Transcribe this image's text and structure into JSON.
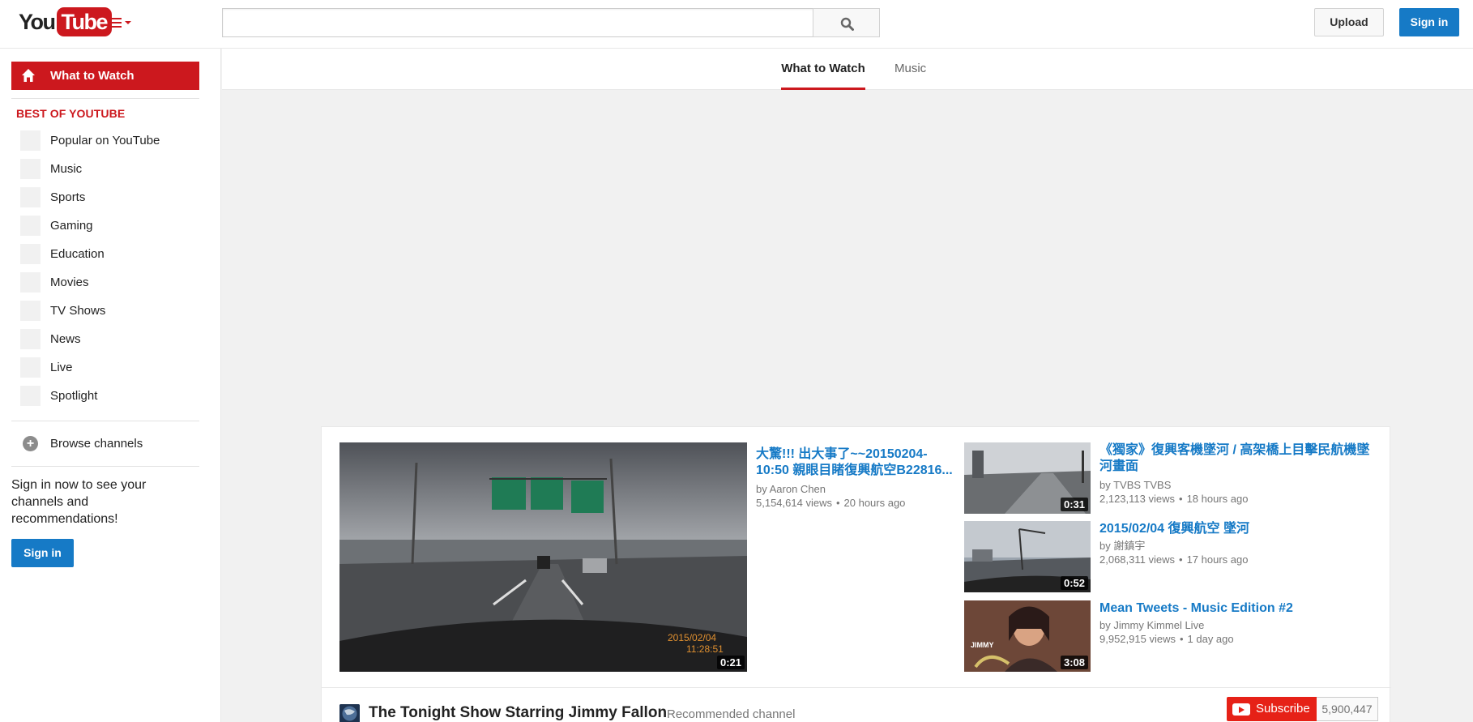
{
  "header": {
    "logo_you": "You",
    "logo_tube": "Tube",
    "search_placeholder": "",
    "upload_label": "Upload",
    "signin_label": "Sign in"
  },
  "sidebar": {
    "what_to_watch": "What to Watch",
    "best_header": "BEST OF YOUTUBE",
    "categories": [
      "Popular on YouTube",
      "Music",
      "Sports",
      "Gaming",
      "Education",
      "Movies",
      "TV Shows",
      "News",
      "Live",
      "Spotlight"
    ],
    "browse_channels": "Browse channels",
    "signin_promo": "Sign in now to see your channels and recommendations!",
    "signin_label": "Sign in"
  },
  "tabs": {
    "what_to_watch": "What to Watch",
    "music": "Music"
  },
  "feed": {
    "featured": {
      "title_line1": "大驚!!! 出大事了~~20150204-",
      "title_line2": "10:50 親眼目睹復興航空B22816...",
      "by": "by Aaron Chen",
      "views": "5,154,614 views",
      "age": "20 hours ago",
      "duration": "0:21",
      "overlay_date": "2015/02/04",
      "overlay_time": "11:28:51"
    },
    "side": [
      {
        "title": "《獨家》復興客機墜河 / 高架橋上目擊民航機墜河畫面",
        "by": "by TVBS TVBS",
        "views": "2,123,113 views",
        "age": "18 hours ago",
        "duration": "0:31"
      },
      {
        "title": "2015/02/04 復興航空 墜河",
        "by": "by 謝鎮宇",
        "views": "2,068,311 views",
        "age": "17 hours ago",
        "duration": "0:52"
      },
      {
        "title": "Mean Tweets - Music Edition #2",
        "by": "by Jimmy Kimmel Live",
        "views": "9,952,915 views",
        "age": "1 day ago",
        "duration": "3:08",
        "thumb_text": "JIMMY"
      }
    ]
  },
  "channel": {
    "name": "The Tonight Show Starring Jimmy Fallon",
    "tag": "Recommended channel",
    "subscribe_label": "Subscribe",
    "subscriber_count": "5,900,447"
  },
  "colors": {
    "brand_red": "#cc181e",
    "link_blue": "#167ac6",
    "subscribe_red": "#e62117"
  }
}
